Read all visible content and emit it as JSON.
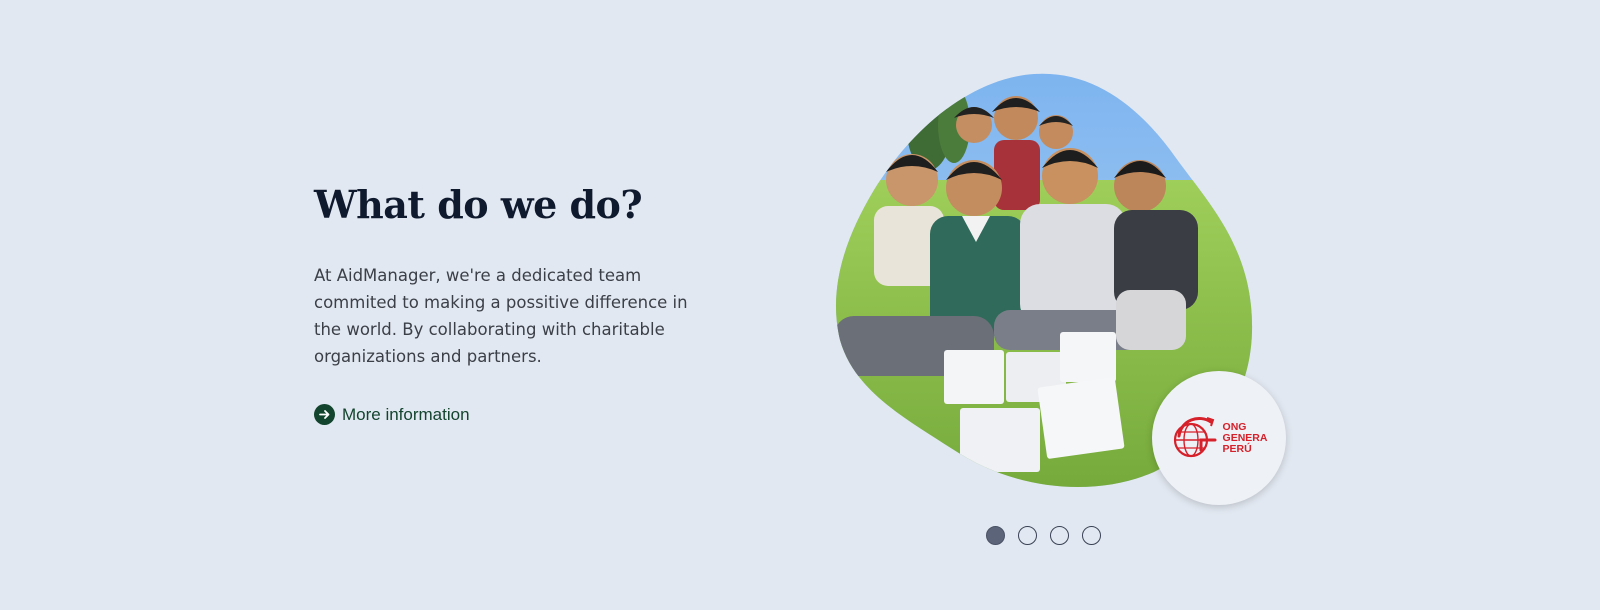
{
  "section": {
    "title": "What do we do?",
    "description": "At AidManager, we're a dedicated team commited to making a possitive difference in the world. By collaborating with charitable organizations and partners.",
    "more_link": {
      "label": "More information",
      "icon": "arrow-right-circle-icon"
    }
  },
  "carousel": {
    "image": {
      "subject": "photo-of-children-sitting-on-grass"
    },
    "partner_logo": {
      "lines": [
        "ONG",
        "GENERA",
        "PERÚ"
      ],
      "color": "#d6202a"
    },
    "slides": [
      {
        "label": "Slide 1",
        "active": true
      },
      {
        "label": "Slide 2",
        "active": false
      },
      {
        "label": "Slide 3",
        "active": false
      },
      {
        "label": "Slide 4",
        "active": false
      }
    ]
  },
  "colors": {
    "background": "#e2e8f1",
    "heading": "#0f1a2e",
    "body_text": "#3b3f47",
    "link": "#12442e",
    "active_dot": "#5b6478"
  }
}
